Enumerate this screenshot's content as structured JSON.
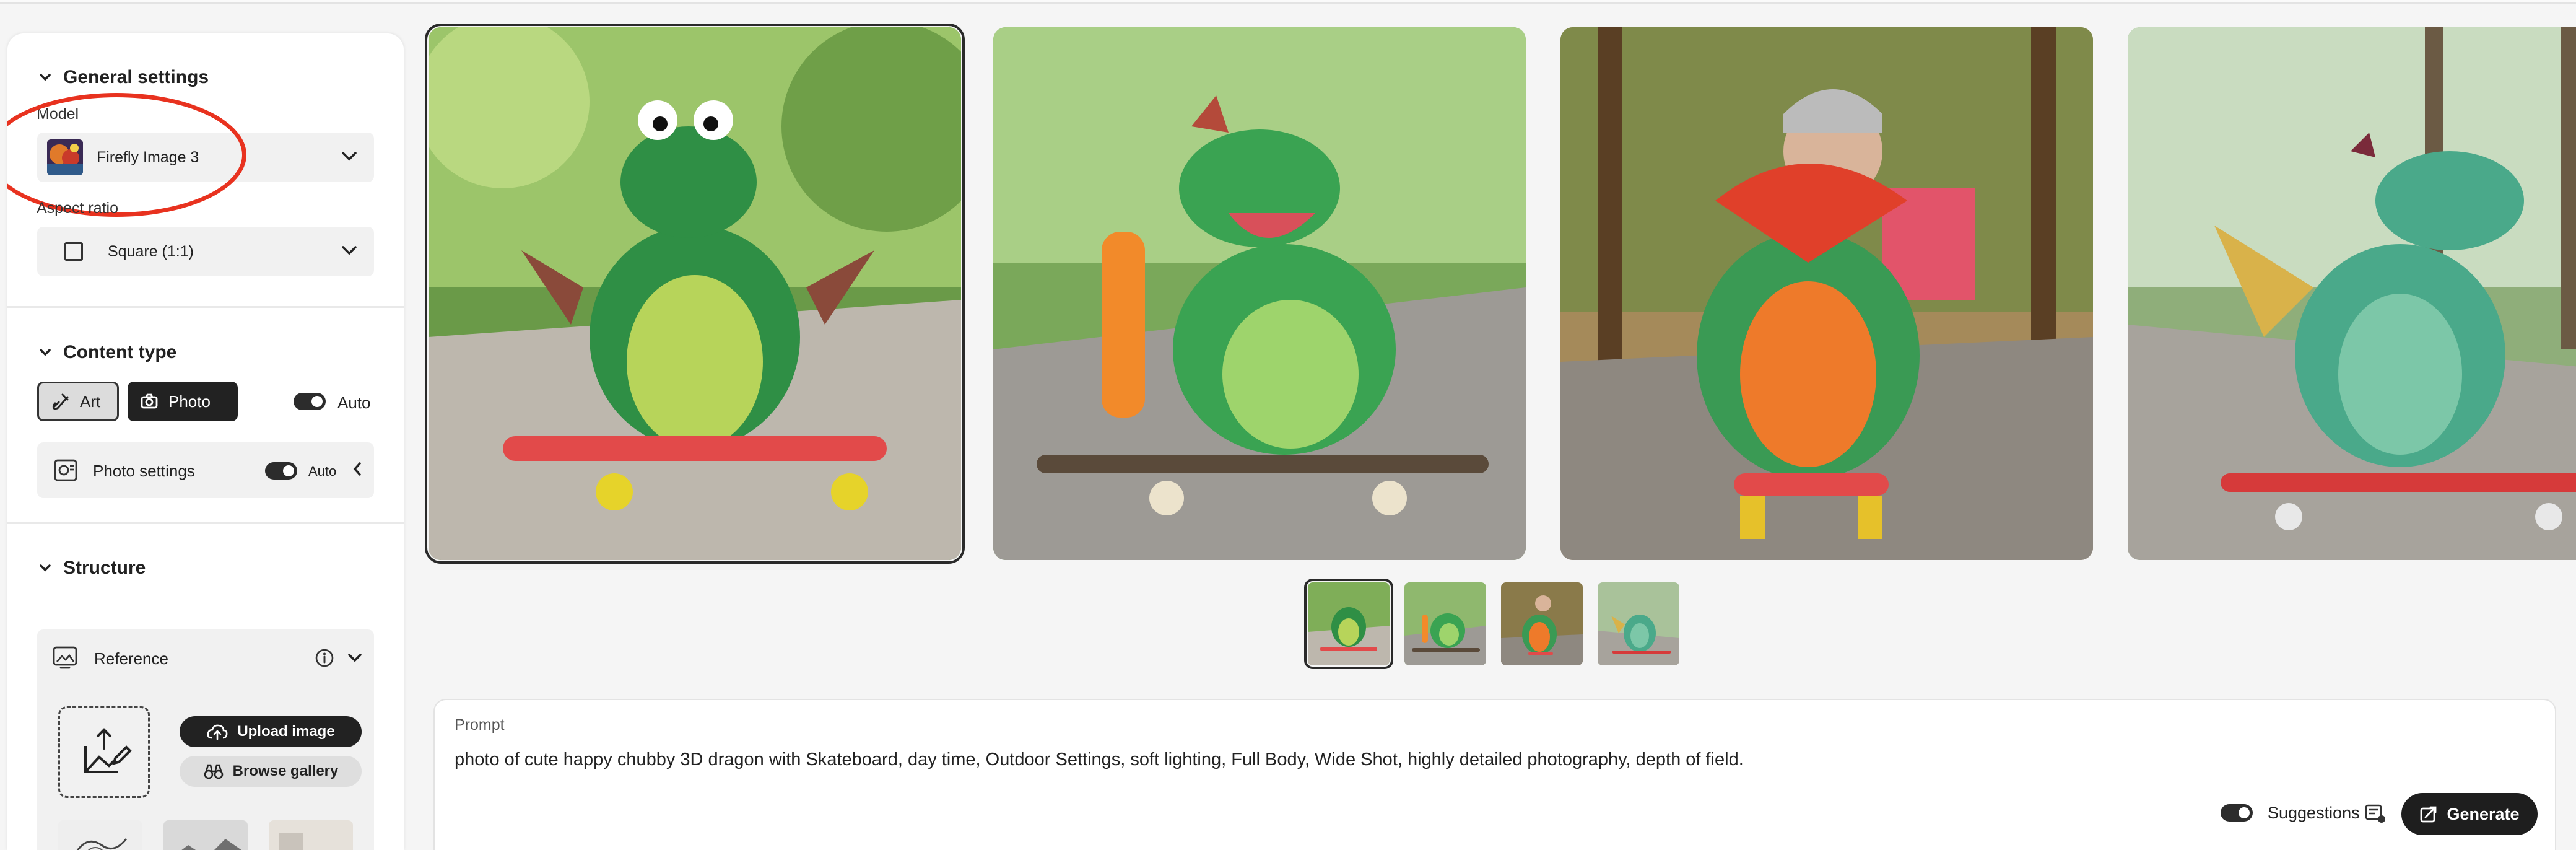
{
  "sidebar": {
    "general": {
      "title": "General settings",
      "model_label": "Model",
      "model_value": "Firefly Image 3",
      "aspect_label": "Aspect ratio",
      "aspect_value": "Square (1:1)"
    },
    "content_type": {
      "title": "Content type",
      "art_label": "Art",
      "photo_label": "Photo",
      "auto_label": "Auto",
      "photo_settings_label": "Photo settings",
      "photo_settings_auto": "Auto"
    },
    "structure": {
      "title": "Structure",
      "reference_label": "Reference",
      "upload_label": "Upload image",
      "browse_label": "Browse gallery"
    }
  },
  "prompt": {
    "label": "Prompt",
    "text": "photo of cute happy chubby 3D dragon with Skateboard, day time, Outdoor Settings, soft lighting, Full Body, Wide Shot, highly detailed photography, depth of field.",
    "suggestions_label": "Suggestions",
    "generate_label": "Generate"
  },
  "colors": {
    "highlight_oval": "#e8321f",
    "dark_button": "#1e1e1e",
    "panel_bg": "#ffffff",
    "page_bg": "#f5f5f5"
  },
  "icons": [
    "chevron-down-icon",
    "art-brush-icon",
    "camera-icon",
    "photo-settings-icon",
    "chevron-left-icon",
    "reference-icon",
    "info-icon",
    "upload-cloud-icon",
    "binoculars-icon",
    "image-upload-icon",
    "suggestions-icon",
    "generate-icon"
  ]
}
